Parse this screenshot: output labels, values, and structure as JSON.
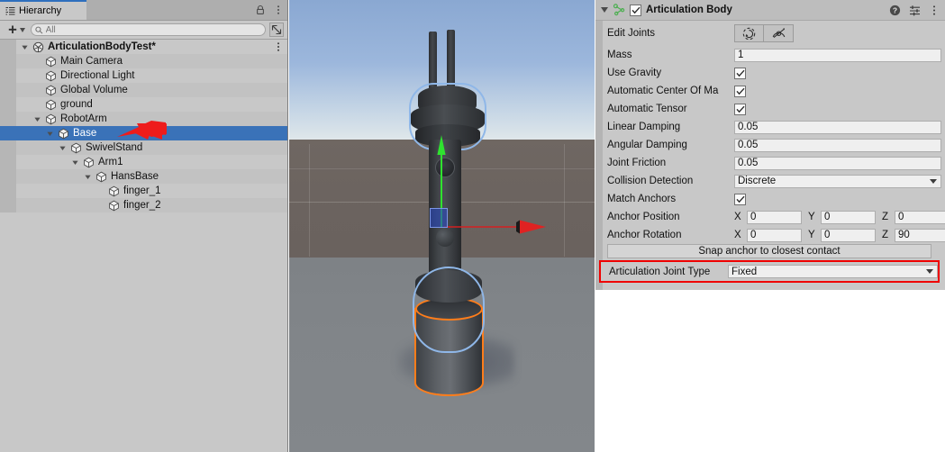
{
  "hierarchy": {
    "tab_label": "Hierarchy",
    "tab_icon": "list-icon",
    "lock_icon": "lock-icon",
    "menu_icon": "kebab-menu-icon",
    "create_label": "+",
    "search": {
      "placeholder": "All",
      "value": "",
      "icon": "search-icon"
    },
    "visibility_icon": "scene-visibility-icon",
    "items": [
      {
        "label": "ArticulationBodyTest*",
        "depth": 0,
        "expanded": true,
        "icon": "scene-icon",
        "bold": true,
        "selected": false,
        "has_menu": true
      },
      {
        "label": "Main Camera",
        "depth": 1,
        "expanded": null,
        "icon": "gameobject-icon",
        "bold": false,
        "selected": false,
        "has_menu": false
      },
      {
        "label": "Directional Light",
        "depth": 1,
        "expanded": null,
        "icon": "gameobject-icon",
        "bold": false,
        "selected": false,
        "has_menu": false
      },
      {
        "label": "Global Volume",
        "depth": 1,
        "expanded": null,
        "icon": "gameobject-icon",
        "bold": false,
        "selected": false,
        "has_menu": false
      },
      {
        "label": "ground",
        "depth": 1,
        "expanded": null,
        "icon": "gameobject-icon",
        "bold": false,
        "selected": false,
        "has_menu": false
      },
      {
        "label": "RobotArm",
        "depth": 1,
        "expanded": true,
        "icon": "gameobject-icon",
        "bold": false,
        "selected": false,
        "has_menu": false
      },
      {
        "label": "Base",
        "depth": 2,
        "expanded": true,
        "icon": "gameobject-icon",
        "bold": false,
        "selected": true,
        "has_menu": false
      },
      {
        "label": "SwivelStand",
        "depth": 3,
        "expanded": true,
        "icon": "gameobject-icon",
        "bold": false,
        "selected": false,
        "has_menu": false
      },
      {
        "label": "Arm1",
        "depth": 4,
        "expanded": true,
        "icon": "gameobject-icon",
        "bold": false,
        "selected": false,
        "has_menu": false
      },
      {
        "label": "HansBase",
        "depth": 5,
        "expanded": true,
        "icon": "gameobject-icon",
        "bold": false,
        "selected": false,
        "has_menu": false
      },
      {
        "label": "finger_1",
        "depth": 6,
        "expanded": null,
        "icon": "gameobject-icon",
        "bold": false,
        "selected": false,
        "has_menu": false
      },
      {
        "label": "finger_2",
        "depth": 6,
        "expanded": null,
        "icon": "gameobject-icon",
        "bold": false,
        "selected": false,
        "has_menu": false
      }
    ],
    "annotation": {
      "type": "red-arrow",
      "points_at": "Base",
      "color": "#ee1c1c"
    }
  },
  "scene": {
    "name": "scene-view",
    "sky_color": "#93b0d6",
    "ground_far_color": "#6b635f",
    "ground_near_color": "#818589",
    "selection_outline_color": "#ff7d1a",
    "hover_outline_color": "#8fb7e8",
    "gizmo": {
      "y_axis_color": "#2fe32f",
      "x_axis_color": "#e02020",
      "z_handle_color": "#3150c8",
      "tool": "move-tool"
    },
    "objects": [
      "robot-arm-prongs",
      "robot-arm-head",
      "robot-arm-column",
      "robot-arm-base-cylinder",
      "ground-plane"
    ]
  },
  "inspector": {
    "component": {
      "title": "Articulation Body",
      "icon": "articulation-body-icon",
      "icon_color": "#4caf50",
      "enabled": true,
      "foldout_expanded": true,
      "help_icon": "help-icon",
      "preset_icon": "preset-icon",
      "menu_icon": "kebab-menu-icon"
    },
    "edit_joints": {
      "label": "Edit Joints",
      "buttons": [
        {
          "name": "edit-joint-angular-limits-button",
          "icon": "joint-rotation-icon"
        },
        {
          "name": "edit-joint-anchor-button",
          "icon": "joint-anchor-icon"
        }
      ]
    },
    "fields": [
      {
        "name": "mass",
        "label": "Mass",
        "type": "text",
        "value": "1"
      },
      {
        "name": "use-gravity",
        "label": "Use Gravity",
        "type": "checkbox",
        "value": true
      },
      {
        "name": "automatic-center-of-mass",
        "label": "Automatic Center Of Ma",
        "type": "checkbox",
        "value": true
      },
      {
        "name": "automatic-tensor",
        "label": "Automatic Tensor",
        "type": "checkbox",
        "value": true
      },
      {
        "name": "linear-damping",
        "label": "Linear Damping",
        "type": "text",
        "value": "0.05"
      },
      {
        "name": "angular-damping",
        "label": "Angular Damping",
        "type": "text",
        "value": "0.05"
      },
      {
        "name": "joint-friction",
        "label": "Joint Friction",
        "type": "text",
        "value": "0.05"
      },
      {
        "name": "collision-detection",
        "label": "Collision Detection",
        "type": "dropdown",
        "value": "Discrete"
      },
      {
        "name": "match-anchors",
        "label": "Match Anchors",
        "type": "checkbox",
        "value": true
      }
    ],
    "anchor_position": {
      "label": "Anchor Position",
      "axes": [
        "X",
        "Y",
        "Z"
      ],
      "values": [
        "0",
        "0",
        "0"
      ]
    },
    "anchor_rotation": {
      "label": "Anchor Rotation",
      "axes": [
        "X",
        "Y",
        "Z"
      ],
      "values": [
        "0",
        "0",
        "90"
      ]
    },
    "snap_button": {
      "label": "Snap anchor to closest contact"
    },
    "joint_type": {
      "label": "Articulation Joint Type",
      "value": "Fixed",
      "highlight_color": "#ef0000",
      "highlighted": true
    }
  }
}
